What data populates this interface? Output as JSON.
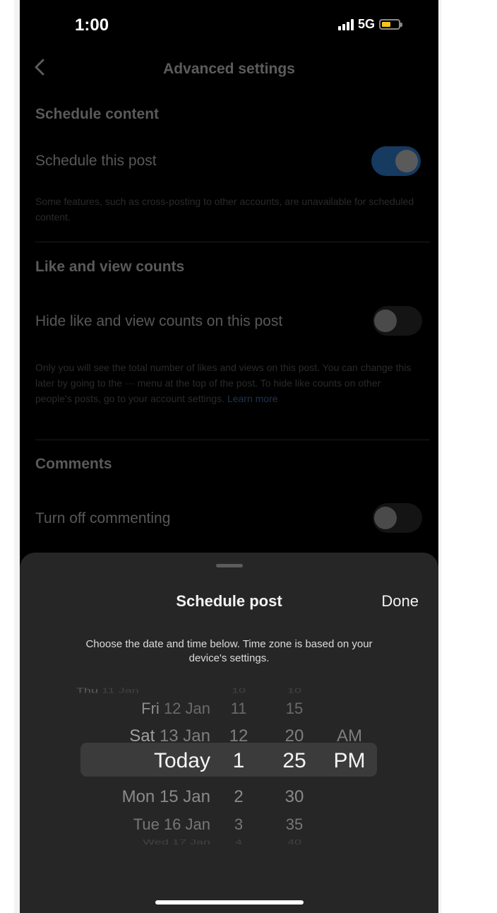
{
  "status_bar": {
    "time": "1:00",
    "network": "5G",
    "battery_color": "#f5c518"
  },
  "nav": {
    "title": "Advanced settings",
    "back_icon": "chevron-left-icon"
  },
  "sections": {
    "schedule": {
      "heading": "Schedule content",
      "toggle_label": "Schedule this post",
      "toggle_on": true,
      "note": "Some features, such as cross-posting to other accounts, are unavailable for scheduled content."
    },
    "likes": {
      "heading": "Like and view counts",
      "toggle_label": "Hide like and view counts on this post",
      "toggle_on": false,
      "note": "Only you will see the total number of likes and views on this post. You can change this later by going to the ··· menu at the top of the post. To hide like counts on other people's posts, go to your account settings.",
      "note_link": "Learn more"
    },
    "comments": {
      "heading": "Comments",
      "toggle_label": "Turn off commenting",
      "toggle_on": false
    }
  },
  "sheet": {
    "title": "Schedule post",
    "done_label": "Done",
    "subtitle": "Choose the date and time below. Time zone is based on your device's settings.",
    "picker": {
      "dates": [
        {
          "day": "Thu",
          "date": "11 Jan"
        },
        {
          "day": "Fri",
          "date": "12 Jan"
        },
        {
          "day": "Sat",
          "date": "13 Jan"
        },
        {
          "day": "",
          "date": "Today"
        },
        {
          "day": "Mon",
          "date": "15 Jan"
        },
        {
          "day": "Tue",
          "date": "16 Jan"
        },
        {
          "day": "Wed",
          "date": "17 Jan"
        }
      ],
      "hours": [
        "10",
        "11",
        "12",
        "1",
        "2",
        "3",
        "4"
      ],
      "minutes": [
        "10",
        "15",
        "20",
        "25",
        "30",
        "35",
        "40"
      ],
      "ampm": [
        "",
        "",
        "AM",
        "PM",
        "",
        "",
        ""
      ],
      "selected_date": "Today",
      "selected_hour": "1",
      "selected_minute": "25",
      "selected_ampm": "PM"
    }
  },
  "colors": {
    "sheet_bg": "#262626",
    "toggle_on": "#163a60",
    "selection_band": "#3b3b3b"
  }
}
